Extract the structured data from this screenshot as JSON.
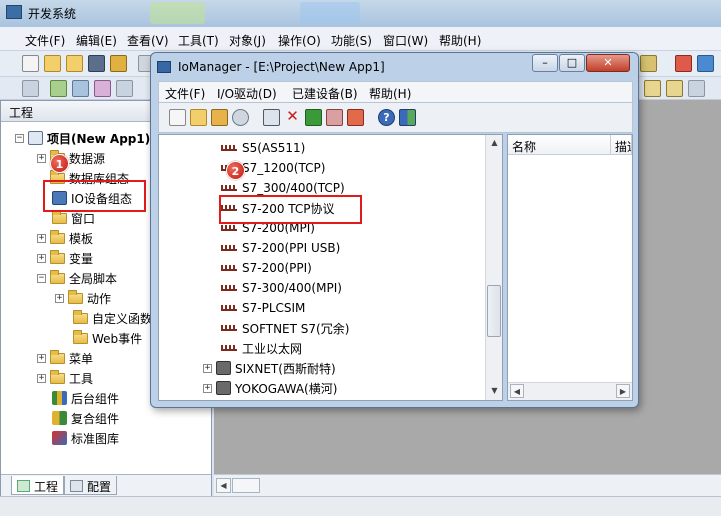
{
  "window": {
    "title": "开发系统"
  },
  "menu": [
    "文件(F)",
    "编辑(E)",
    "查看(V)",
    "工具(T)",
    "对象(J)",
    "操作(O)",
    "功能(S)",
    "窗口(W)",
    "帮助(H)"
  ],
  "project_panel": {
    "header": "工程",
    "root": "项目(New App1)",
    "items": [
      "数据源",
      "数据库组态",
      "IO设备组态",
      "窗口",
      "模板",
      "变量",
      "全局脚本",
      "动作",
      "自定义函数",
      "Web事件",
      "菜单",
      "工具",
      "后台组件",
      "复合组件",
      "标准图库"
    ],
    "tabs": [
      "工程",
      "配置"
    ]
  },
  "dialog": {
    "title": "IoManager - [E:\\Project\\New App1]",
    "menu": [
      "文件(F)",
      "I/O驱动(D)",
      "已建设备(B)",
      "帮助(H)"
    ],
    "devices": [
      "S5(AS511)",
      "S7_1200(TCP)",
      "S7_300/400(TCP)",
      "S7-200 TCP协议",
      "S7-200(MPI)",
      "S7-200(PPI USB)",
      "S7-200(PPI)",
      "S7-300/400(MPI)",
      "S7-PLCSIM",
      "SOFTNET S7(冗余)",
      "工业以太网"
    ],
    "vendors": [
      "SIXNET(西斯耐特)",
      "YOKOGAWA(横河)"
    ],
    "columns": [
      "名称",
      "描述"
    ]
  },
  "annotations": {
    "step1": "1",
    "step2": "2",
    "highlight_color": "#e11b1b"
  }
}
